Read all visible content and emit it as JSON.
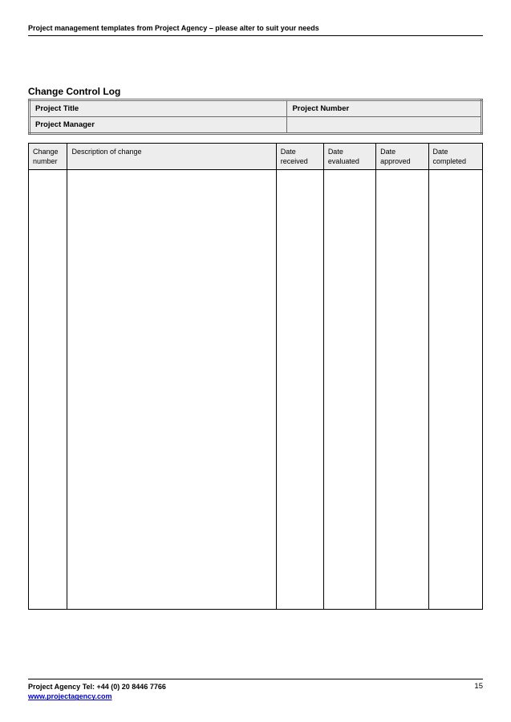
{
  "header": {
    "text": "Project management templates from Project Agency – please alter to suit your needs"
  },
  "title": "Change Control Log",
  "info_table": {
    "project_title_label": "Project Title",
    "project_number_label": "Project Number",
    "project_manager_label": "Project Manager"
  },
  "log_table": {
    "headers": {
      "change_number": "Change number",
      "description": "Description of change",
      "date_received": "Date received",
      "date_evaluated": "Date evaluated",
      "date_approved": "Date approved",
      "date_completed": "Date completed"
    }
  },
  "footer": {
    "tel": "Project Agency Tel: +44 (0) 20 8446 7766",
    "url": "www.projectagency.com",
    "page_number": "15"
  }
}
